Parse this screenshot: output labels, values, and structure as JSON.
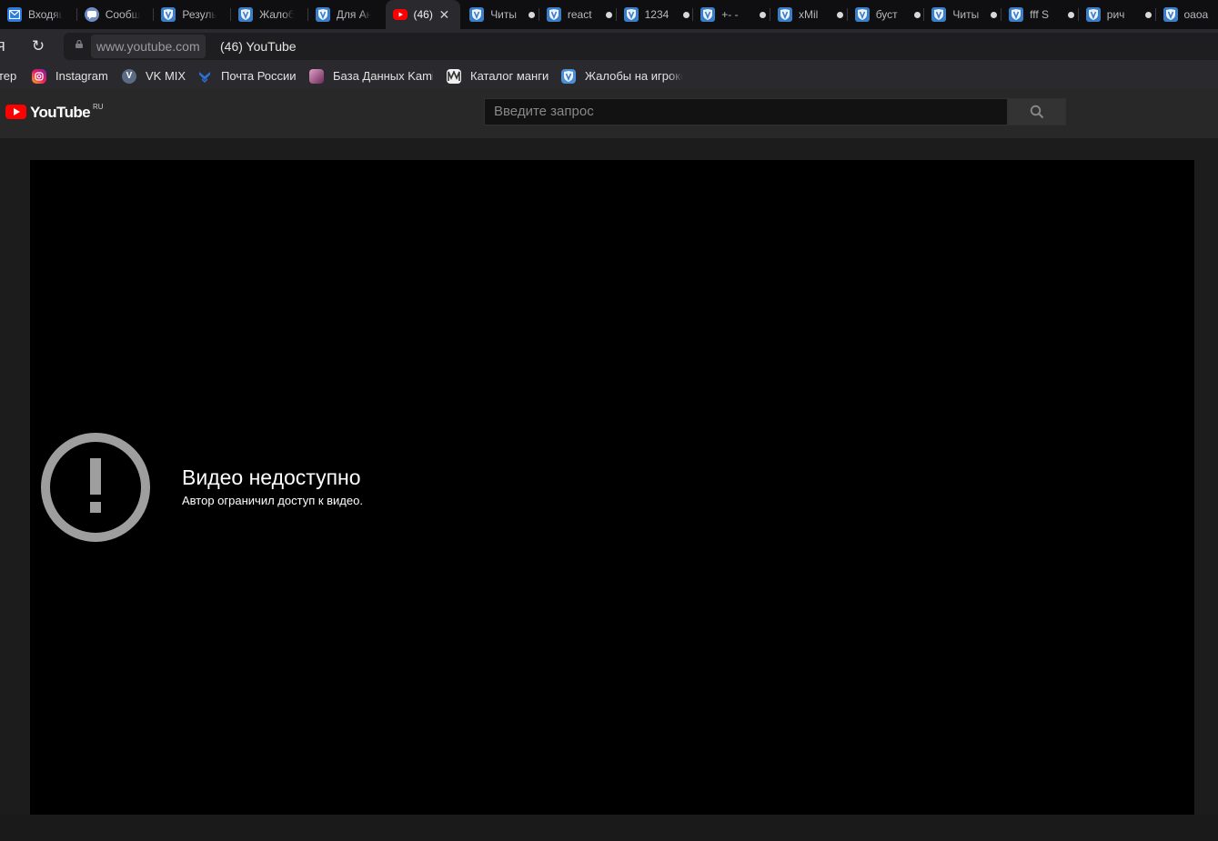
{
  "browser": {
    "tabs": [
      {
        "title": "Входящие",
        "icon": "mail-icon",
        "active": false,
        "unread": false
      },
      {
        "title": "Сообщения",
        "icon": "message-icon",
        "active": false,
        "unread": false
      },
      {
        "title": "Результаты",
        "icon": "vk-shield-icon",
        "active": false,
        "unread": false
      },
      {
        "title": "Жалобы",
        "icon": "vk-shield-icon",
        "active": false,
        "unread": false
      },
      {
        "title": "Для Ан",
        "icon": "vk-shield-icon",
        "active": false,
        "unread": false
      },
      {
        "title": "(46)",
        "icon": "youtube-icon",
        "active": true,
        "unread": false
      },
      {
        "title": "Читы",
        "icon": "vk-shield-icon",
        "active": false,
        "unread": true
      },
      {
        "title": "react",
        "icon": "vk-shield-icon",
        "active": false,
        "unread": true
      },
      {
        "title": "1234",
        "icon": "vk-shield-icon",
        "active": false,
        "unread": true
      },
      {
        "title": "+- -",
        "icon": "vk-shield-icon",
        "active": false,
        "unread": true
      },
      {
        "title": "xMil",
        "icon": "vk-shield-icon",
        "active": false,
        "unread": true
      },
      {
        "title": "буст",
        "icon": "vk-shield-icon",
        "active": false,
        "unread": true
      },
      {
        "title": "Читы",
        "icon": "vk-shield-icon",
        "active": false,
        "unread": true
      },
      {
        "title": "fff S",
        "icon": "vk-shield-icon",
        "active": false,
        "unread": true
      },
      {
        "title": "рич",
        "icon": "vk-shield-icon",
        "active": false,
        "unread": true
      },
      {
        "title": "оаоа",
        "icon": "vk-shield-icon",
        "active": false,
        "unread": true
      }
    ],
    "back_fragment": "я",
    "address": {
      "host": "www.youtube.com",
      "title": "(46) YouTube"
    },
    "bookmarks": [
      {
        "label": "тер",
        "icon": "none"
      },
      {
        "label": "Instagram",
        "icon": "instagram-icon"
      },
      {
        "label": "VK MIX",
        "icon": "vk-mix-icon"
      },
      {
        "label": "Почта России",
        "icon": "post-russia-icon"
      },
      {
        "label": "База Данных Kami",
        "icon": "anime-icon"
      },
      {
        "label": "Каталог манги",
        "icon": "manga-icon"
      },
      {
        "label": "Жалобы на игроков",
        "icon": "vk-shield-icon"
      }
    ]
  },
  "youtube": {
    "logo_text": "YouTube",
    "region": "RU",
    "search_placeholder": "Введите запрос",
    "player": {
      "error_title": "Видео недоступно",
      "error_message": "Автор ограничил доступ к видео."
    }
  },
  "colors": {
    "brand_red": "#ff0000",
    "tab_bg": "#0f0f12",
    "toolbar_bg": "#2a2a2e",
    "page_bg": "#1c1c1c",
    "player_bg": "#000000",
    "error_icon": "#9e9e9e"
  }
}
